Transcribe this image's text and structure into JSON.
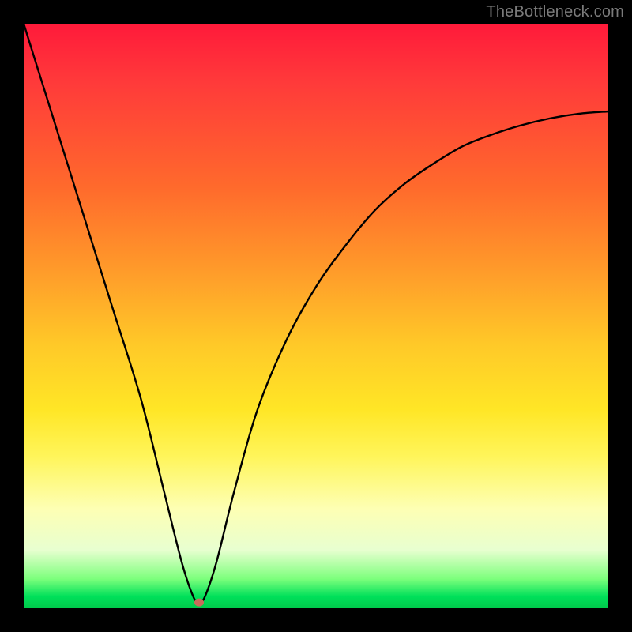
{
  "watermark": "TheBottleneck.com",
  "chart_data": {
    "type": "line",
    "title": "",
    "xlabel": "",
    "ylabel": "",
    "xlim": [
      0,
      100
    ],
    "ylim": [
      0,
      100
    ],
    "x": [
      0,
      5,
      10,
      15,
      20,
      24,
      27,
      29,
      30,
      31,
      33,
      36,
      40,
      45,
      50,
      55,
      60,
      65,
      70,
      75,
      80,
      85,
      90,
      95,
      100
    ],
    "values": [
      100,
      84,
      68,
      52,
      36,
      20,
      8,
      2,
      1,
      2,
      8,
      20,
      34,
      46,
      55,
      62,
      68,
      72.5,
      76,
      79,
      81,
      82.6,
      83.8,
      84.6,
      85
    ],
    "marker": {
      "x": 30,
      "y": 1
    },
    "grid": false,
    "legend": false
  },
  "colors": {
    "top": "#ff1a3a",
    "mid": "#ffe626",
    "bottom": "#00c94b",
    "curve": "#000000",
    "marker": "#c96b5a",
    "watermark": "#7a7a7a",
    "frame": "#000000"
  }
}
